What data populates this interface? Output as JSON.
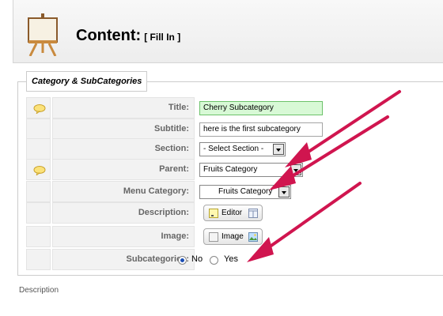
{
  "header": {
    "title": "Content:",
    "subtitle": "[ Fill In ]",
    "icon": "easel-icon"
  },
  "fieldset": {
    "legend": "Category & SubCategories"
  },
  "fields": {
    "title": {
      "label": "Title:",
      "value": "Cherry Subcategory"
    },
    "subtitle": {
      "label": "Subtitle:",
      "value": "here is the first subcategory"
    },
    "section": {
      "label": "Section:",
      "selected": "- Select Section -"
    },
    "parent": {
      "label": "Parent:",
      "selected": "Fruits Category"
    },
    "menu_category": {
      "label": "Menu Category:",
      "selected": "Fruits Category"
    },
    "description": {
      "label": "Description:",
      "button": "Editor"
    },
    "image": {
      "label": "Image:",
      "button": "Image"
    },
    "subcategories": {
      "label": "Subcategories:",
      "options": [
        "No",
        "Yes"
      ],
      "selected": "No"
    }
  },
  "footer": {
    "description_label": "Description"
  },
  "colors": {
    "arrow": "#d0154f",
    "highlight_field": "#d8f9d6"
  }
}
